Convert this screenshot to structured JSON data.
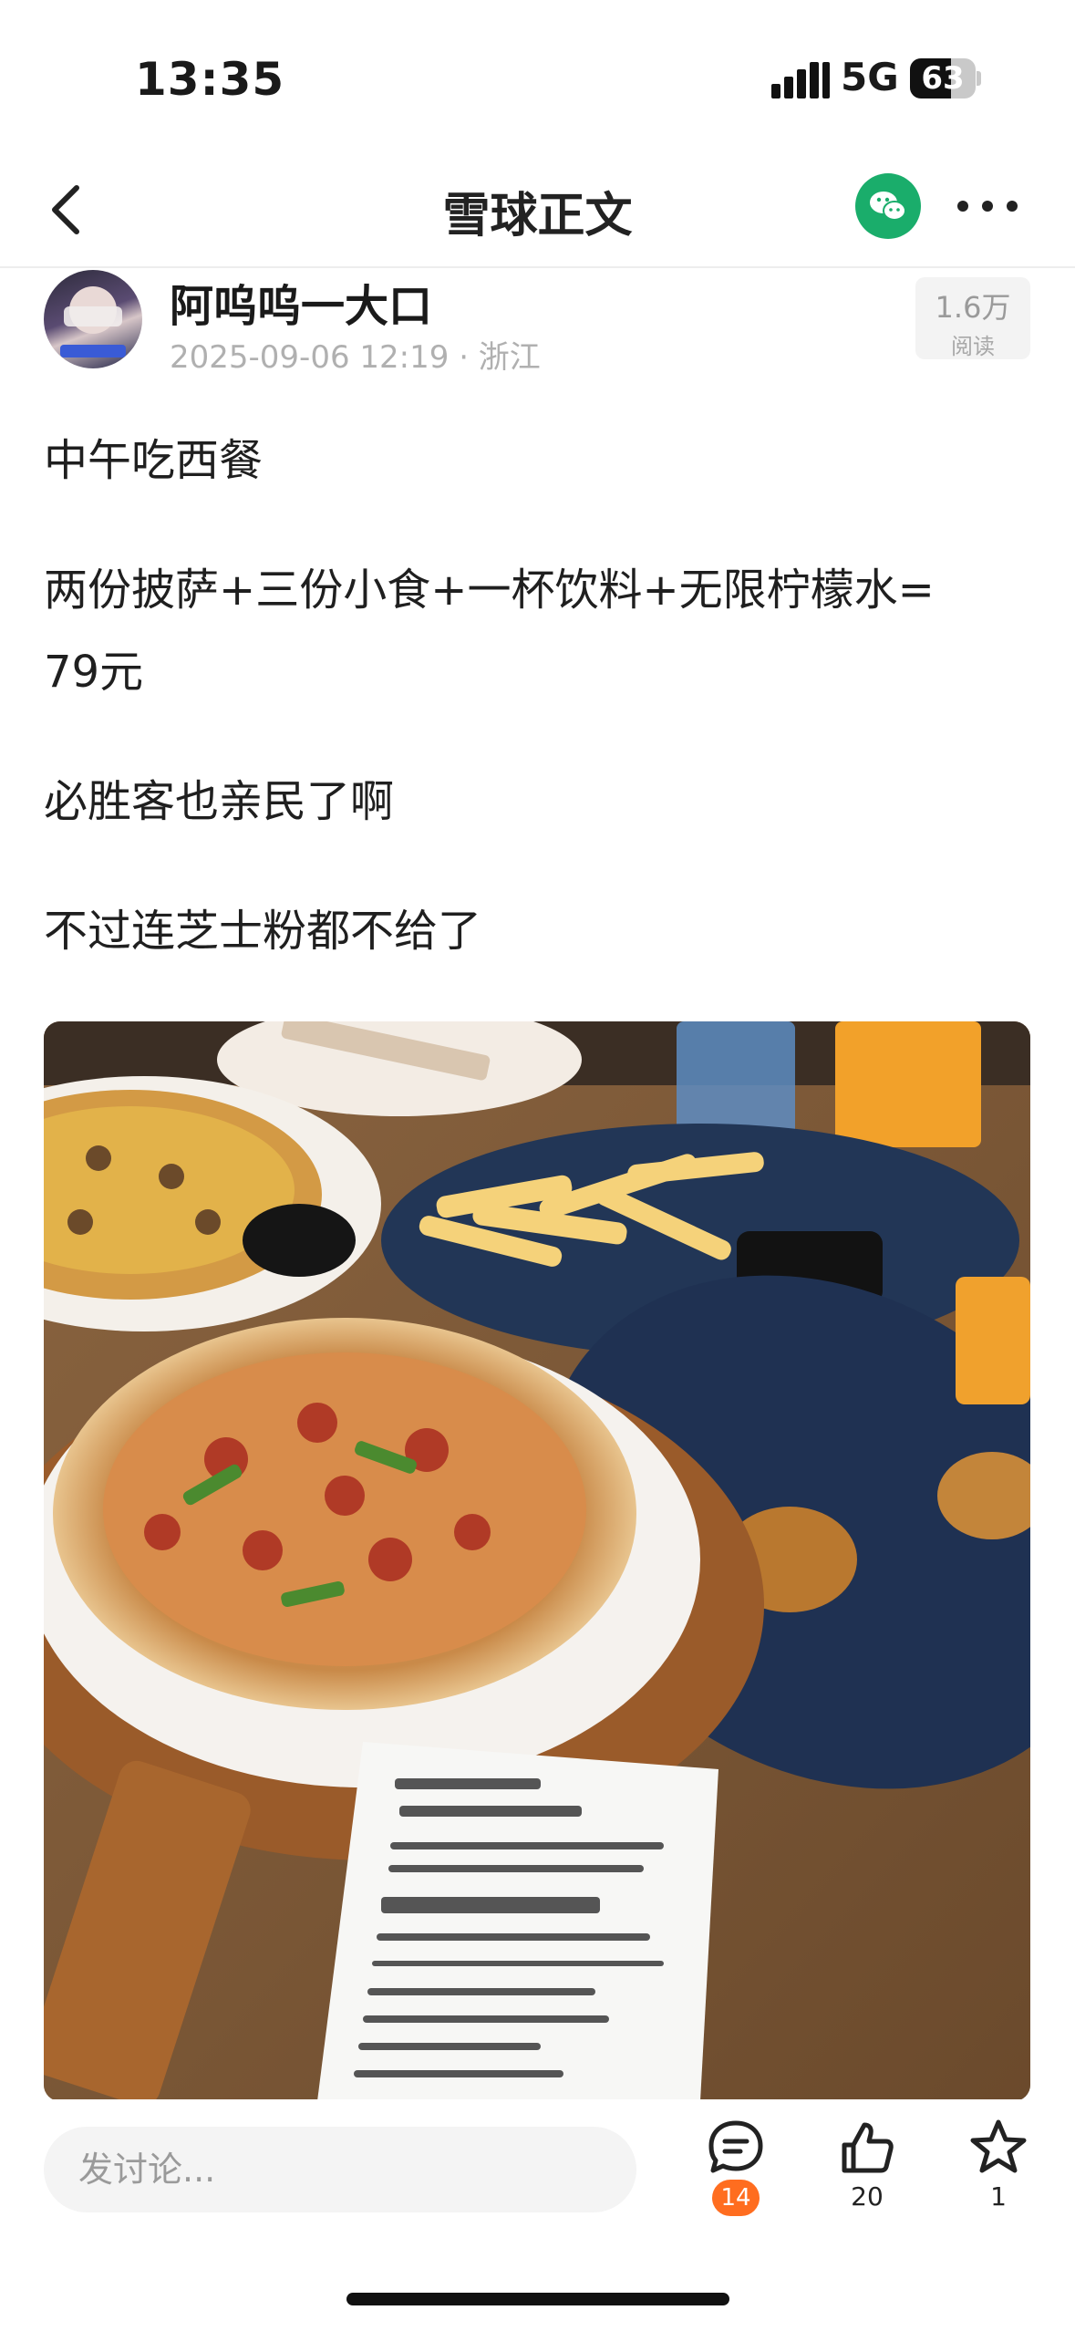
{
  "status_bar": {
    "time": "13:35",
    "network": "5G",
    "battery": "63",
    "battery_level": 0.63
  },
  "nav": {
    "title": "雪球正文"
  },
  "author": {
    "name": "阿呜呜一大口",
    "meta": "2025-09-06 12:19 · 浙江"
  },
  "views": {
    "count": "1.6万",
    "label": "阅读"
  },
  "post": {
    "paragraphs": [
      "中午吃西餐",
      "两份披萨+三份小食+一杯饮料+无限柠檬水=",
      "79元",
      "必胜客也亲民了啊",
      "不过连芝士粉都不给了"
    ]
  },
  "bottom_bar": {
    "comment_placeholder": "发讨论...",
    "comment_count": "14",
    "like_count": "20",
    "favorite_count": "1"
  },
  "colors": {
    "brand_green": "#1aad6b",
    "badge_orange": "#ff6d1f"
  },
  "icons": [
    "back-icon",
    "wechat-icon",
    "more-icon",
    "comment-icon",
    "like-icon",
    "star-icon"
  ]
}
